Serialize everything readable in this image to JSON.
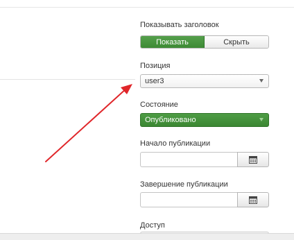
{
  "fields": {
    "show_title": {
      "label": "Показывать заголовок",
      "options": [
        "Показать",
        "Скрыть"
      ],
      "selected": "Показать"
    },
    "position": {
      "label": "Позиция",
      "value": "user3"
    },
    "state": {
      "label": "Состояние",
      "value": "Опубликовано"
    },
    "publish_up": {
      "label": "Начало публикации",
      "value": "",
      "button_icon": "calendar-icon"
    },
    "publish_down": {
      "label": "Завершение публикации",
      "value": "",
      "button_icon": "calendar-icon"
    },
    "access": {
      "label": "Доступ"
    }
  },
  "annotation": {
    "type": "arrow",
    "color": "#e0262a"
  },
  "colors": {
    "active_green": "#46933d",
    "text": "#333333",
    "border": "#b8b8b8"
  }
}
